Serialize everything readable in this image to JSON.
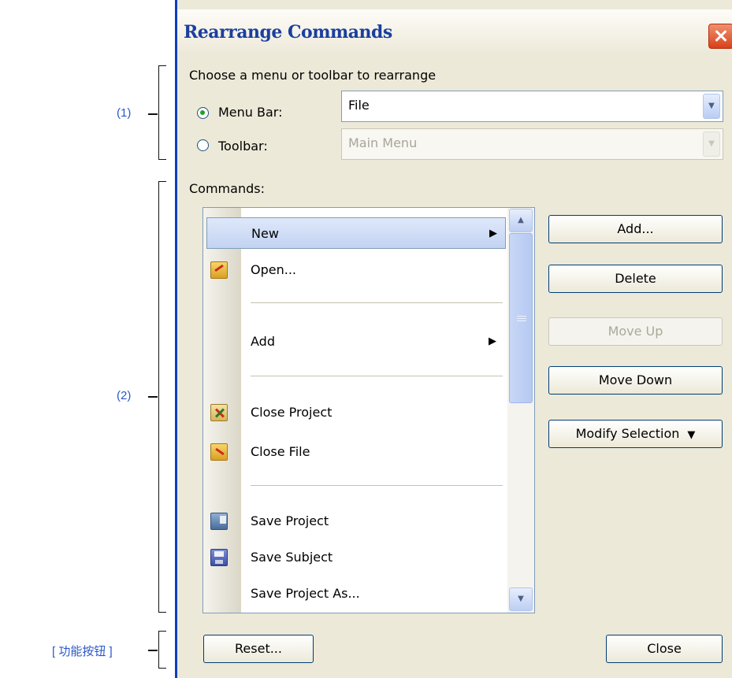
{
  "annotations": {
    "section1": "(1)",
    "section2": "(2)",
    "function_buttons": "[ 功能按钮 ]"
  },
  "dialog": {
    "title": "Rearrange Commands",
    "choose_label": "Choose a menu or toolbar to rearrange",
    "menu_bar_label": "Menu Bar:",
    "menu_bar_value": "File",
    "toolbar_label": "Toolbar:",
    "toolbar_value": "Main Menu",
    "commands_label": "Commands:",
    "commands": [
      {
        "label": "New",
        "submenu": true,
        "selected": true,
        "icon": "none"
      },
      {
        "label": "Open...",
        "submenu": false,
        "icon": "open-folder-icon"
      },
      {
        "label": "Add",
        "submenu": true,
        "icon": "none"
      },
      {
        "label": "Close Project",
        "submenu": false,
        "icon": "close-project-icon"
      },
      {
        "label": "Close File",
        "submenu": false,
        "icon": "close-file-icon"
      },
      {
        "label": "Save Project",
        "submenu": false,
        "icon": "save-project-icon"
      },
      {
        "label": "Save Subject",
        "submenu": false,
        "icon": "floppy-disk-icon"
      },
      {
        "label": "Save Project As...",
        "submenu": false,
        "icon": "none"
      }
    ],
    "buttons": {
      "add": "Add...",
      "delete": "Delete",
      "move_up": "Move Up",
      "move_down": "Move Down",
      "modify_selection": "Modify Selection",
      "reset": "Reset...",
      "close": "Close"
    }
  },
  "colors": {
    "dialog_bg": "#ece9d8",
    "title_text": "#1b3f9e",
    "annotation_text": "#2b57c9",
    "selection": "#c2d3f2",
    "close_button": "#d8411a"
  }
}
